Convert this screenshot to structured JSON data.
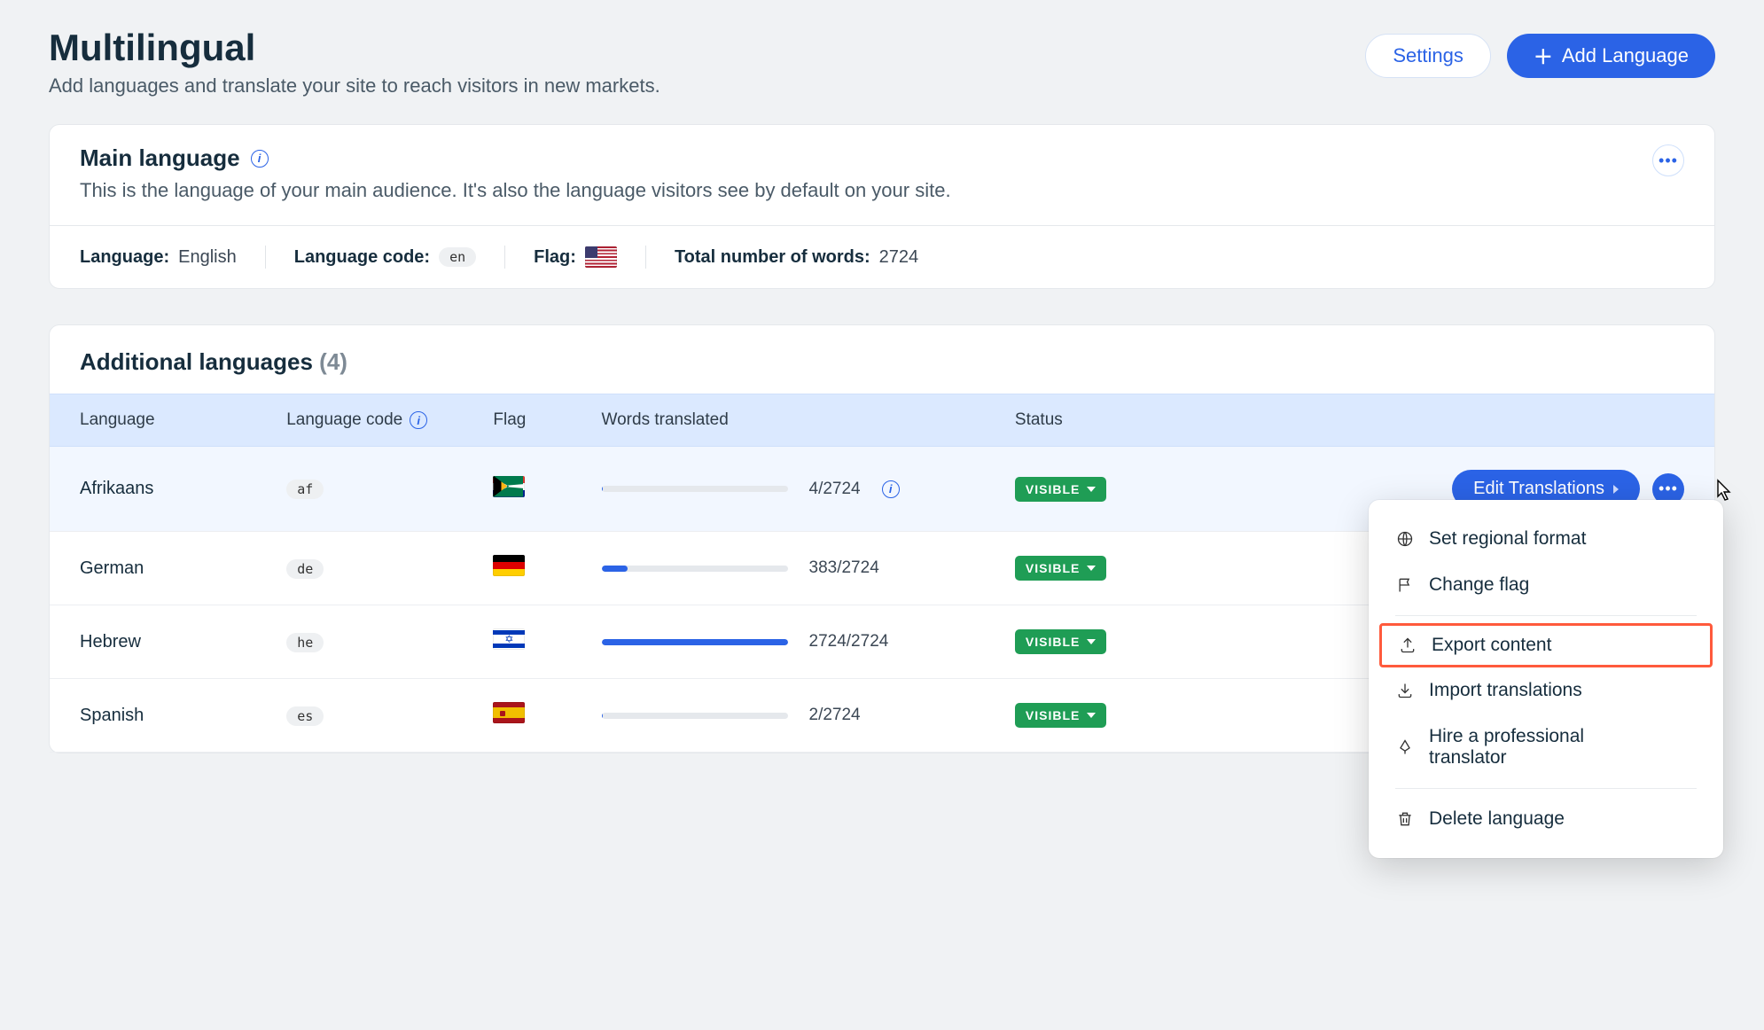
{
  "header": {
    "title": "Multilingual",
    "subtitle": "Add languages and translate your site to reach visitors in new markets.",
    "settings_label": "Settings",
    "add_language_label": "Add Language"
  },
  "main_language": {
    "card_title": "Main language",
    "card_subtitle": "This is the language of your main audience. It's also the language visitors see by default on your site.",
    "labels": {
      "language": "Language:",
      "language_code": "Language code:",
      "flag": "Flag:",
      "total_words": "Total number of words:"
    },
    "values": {
      "language": "English",
      "language_code": "en",
      "flag": "us",
      "total_words": "2724"
    }
  },
  "additional": {
    "title": "Additional languages",
    "count_display": "(4)",
    "columns": {
      "language": "Language",
      "language_code": "Language code",
      "flag": "Flag",
      "words_translated": "Words translated",
      "status": "Status"
    },
    "edit_label": "Edit Translations",
    "status_visible": "VISIBLE",
    "rows": [
      {
        "language": "Afrikaans",
        "code": "af",
        "flag": "za",
        "translated": 4,
        "total": 2724,
        "display": "4/2724",
        "info": true,
        "hover": true
      },
      {
        "language": "German",
        "code": "de",
        "flag": "de",
        "translated": 383,
        "total": 2724,
        "display": "383/2724",
        "info": false,
        "hover": false
      },
      {
        "language": "Hebrew",
        "code": "he",
        "flag": "il",
        "translated": 2724,
        "total": 2724,
        "display": "2724/2724",
        "info": false,
        "hover": false
      },
      {
        "language": "Spanish",
        "code": "es",
        "flag": "es",
        "translated": 2,
        "total": 2724,
        "display": "2/2724",
        "info": false,
        "hover": false
      }
    ]
  },
  "menu": {
    "set_regional": "Set regional format",
    "change_flag": "Change flag",
    "export_content": "Export content",
    "import_translations": "Import translations",
    "hire_translator": "Hire a professional translator",
    "delete_language": "Delete language"
  }
}
